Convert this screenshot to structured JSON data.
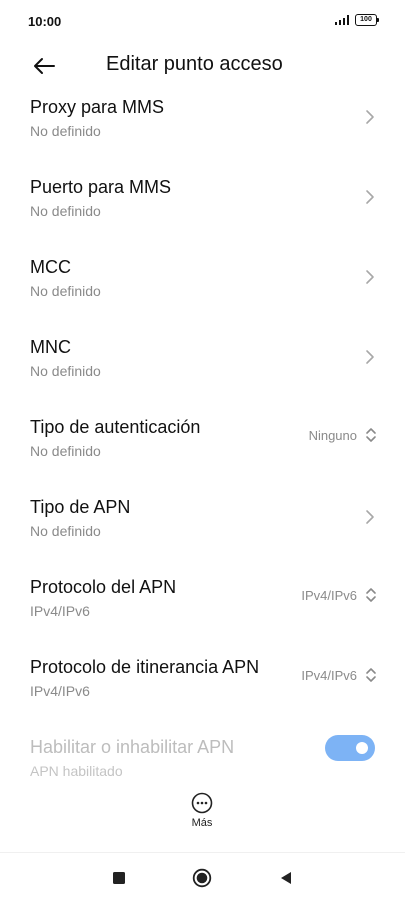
{
  "status_bar": {
    "time": "10:00",
    "battery": "100"
  },
  "header": {
    "title": "Editar punto acceso"
  },
  "rows": [
    {
      "title": "Proxy para MMS",
      "subtitle": "No definido",
      "value": ""
    },
    {
      "title": "Puerto para MMS",
      "subtitle": "No definido",
      "value": ""
    },
    {
      "title": "MCC",
      "subtitle": "No definido",
      "value": ""
    },
    {
      "title": "MNC",
      "subtitle": "No definido",
      "value": ""
    },
    {
      "title": "Tipo de autenticación",
      "subtitle": "No definido",
      "value": "Ninguno"
    },
    {
      "title": "Tipo de APN",
      "subtitle": "No definido",
      "value": ""
    },
    {
      "title": "Protocolo del APN",
      "subtitle": "IPv4/IPv6",
      "value": "IPv4/IPv6"
    },
    {
      "title": "Protocolo de itinerancia APN",
      "subtitle": "IPv4/IPv6",
      "value": "IPv4/IPv6"
    },
    {
      "title": "Habilitar o inhabilitar APN",
      "subtitle": "APN habilitado",
      "toggle_on": true
    }
  ],
  "bottom": {
    "more_label": "Más"
  },
  "colors": {
    "toggle_accent": "#7db3f5",
    "subtitle": "#8a8a8a",
    "disabled_text": "#bdbdbd"
  },
  "icons": [
    "back-arrow-icon",
    "chevron-right-icon",
    "up-down-arrows-icon",
    "more-icon",
    "square-icon",
    "circle-icon",
    "triangle-left-icon",
    "signal-icon",
    "battery-icon"
  ]
}
